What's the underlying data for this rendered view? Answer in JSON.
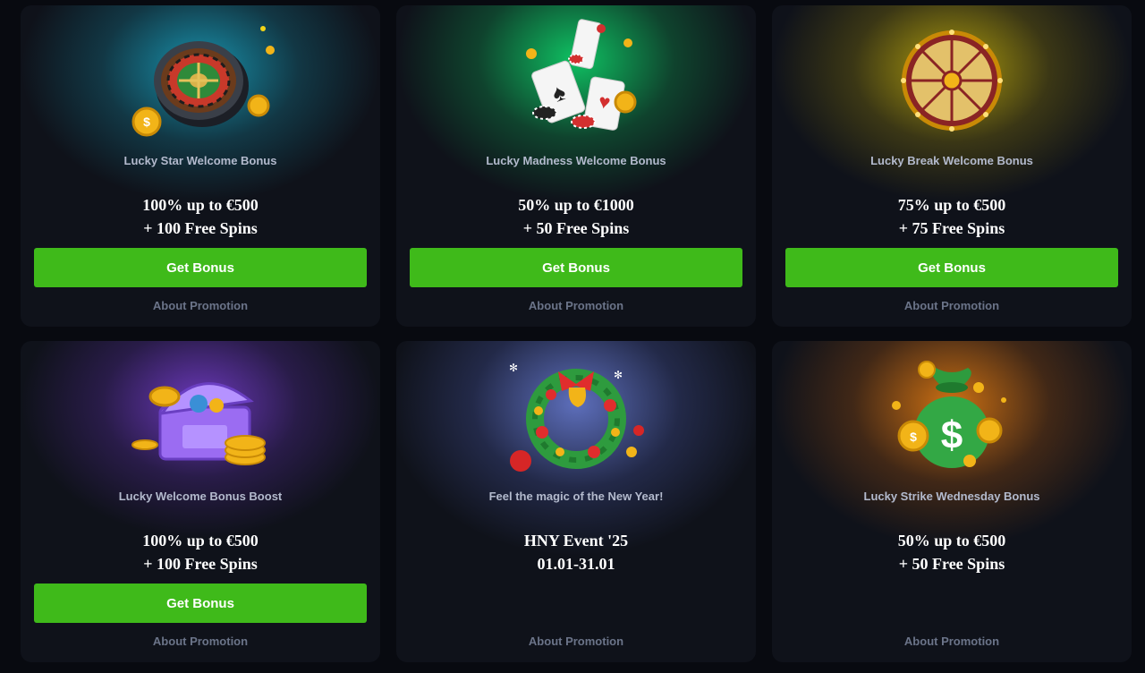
{
  "promotions": [
    {
      "subtitle": "Lucky Star Welcome Bonus",
      "offer_line1": "100% up to €500",
      "offer_line2": "+ 100 Free Spins",
      "button_label": "Get Bonus",
      "about_label": "About Promotion",
      "illustration": "roulette-wheel-icon",
      "glow_color": "#1aa7c4"
    },
    {
      "subtitle": "Lucky Madness Welcome Bonus",
      "offer_line1": "50% up to €1000",
      "offer_line2": "+ 50 Free Spins",
      "button_label": "Get Bonus",
      "about_label": "About Promotion",
      "illustration": "playing-cards-icon",
      "glow_color": "#0fd46a"
    },
    {
      "subtitle": "Lucky Break Welcome Bonus",
      "offer_line1": "75% up to €500",
      "offer_line2": "+ 75 Free Spins",
      "button_label": "Get Bonus",
      "about_label": "About Promotion",
      "illustration": "fortune-wheel-icon",
      "glow_color": "#c9b40a"
    },
    {
      "subtitle": "Lucky Welcome Bonus Boost",
      "offer_line1": "100% up to €500",
      "offer_line2": "+ 100 Free Spins",
      "button_label": "Get Bonus",
      "about_label": "About Promotion",
      "illustration": "treasure-chest-icon",
      "glow_color": "#7b3fd6"
    },
    {
      "subtitle": "Feel the magic of the New Year!",
      "offer_line1": "HNY Event '25",
      "offer_line2": "01.01-31.01",
      "about_label": "About Promotion",
      "illustration": "christmas-wreath-icon",
      "glow_color": "#6b7fd8"
    },
    {
      "subtitle": "Lucky Strike Wednesday Bonus",
      "offer_line1": "50% up to €500",
      "offer_line2": "+ 50 Free Spins",
      "about_label": "About Promotion",
      "illustration": "money-bag-icon",
      "glow_color": "#e07a12"
    }
  ],
  "accent_color": "#3fba1a"
}
